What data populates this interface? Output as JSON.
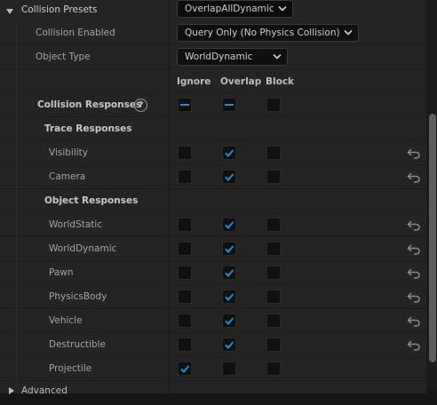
{
  "collision_presets": {
    "label": "Collision Presets",
    "value": "OverlapAllDynamic"
  },
  "collision_enabled": {
    "label": "Collision Enabled",
    "value": "Query Only (No Physics Collision)"
  },
  "object_type": {
    "label": "Object Type",
    "value": "WorldDynamic"
  },
  "columns": {
    "ignore": "Ignore",
    "overlap": "Overlap",
    "block": "Block"
  },
  "collision_responses": {
    "label": "Collision Responses",
    "help": "?"
  },
  "trace_responses": {
    "header": "Trace Responses",
    "items": [
      {
        "label": "Visibility",
        "state": "overlap",
        "resettable": true
      },
      {
        "label": "Camera",
        "state": "overlap",
        "resettable": true
      }
    ]
  },
  "object_responses": {
    "header": "Object Responses",
    "items": [
      {
        "label": "WorldStatic",
        "state": "overlap",
        "resettable": true
      },
      {
        "label": "WorldDynamic",
        "state": "overlap",
        "resettable": true
      },
      {
        "label": "Pawn",
        "state": "overlap",
        "resettable": true
      },
      {
        "label": "PhysicsBody",
        "state": "overlap",
        "resettable": true
      },
      {
        "label": "Vehicle",
        "state": "overlap",
        "resettable": true
      },
      {
        "label": "Destructible",
        "state": "overlap",
        "resettable": true
      },
      {
        "label": "Projectile",
        "state": "ignore",
        "resettable": false
      }
    ]
  },
  "advanced": {
    "label": "Advanced"
  },
  "colors": {
    "background": "#151515",
    "row": "#242424",
    "accent": "#1f8fd6",
    "text": "#c0c0c0"
  }
}
